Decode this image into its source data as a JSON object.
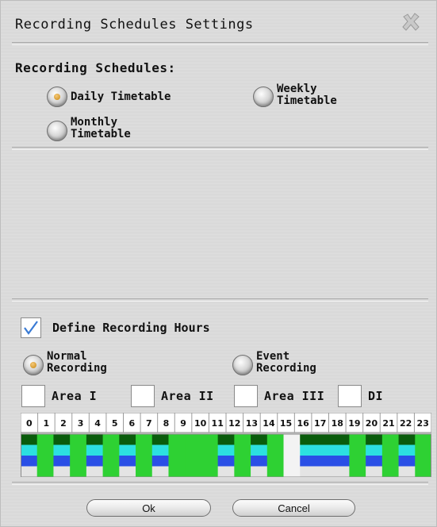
{
  "title": "Recording Schedules Settings",
  "schedules": {
    "heading": "Recording Schedules:",
    "daily": {
      "label": "Daily Timetable",
      "selected": true
    },
    "weekly": {
      "line1": "Weekly",
      "line2": "Timetable",
      "selected": false
    },
    "monthly": {
      "line1": "Monthly",
      "line2": "Timetable",
      "selected": false
    }
  },
  "define_hours": {
    "label": "Define Recording Hours",
    "checked": true
  },
  "mode": {
    "normal": {
      "line1": "Normal",
      "line2": "Recording",
      "selected": true
    },
    "event": {
      "line1": "Event",
      "line2": "Recording",
      "selected": false
    }
  },
  "areas": [
    {
      "label": "Area I",
      "checked": false
    },
    {
      "label": "Area II",
      "checked": false
    },
    {
      "label": "Area III",
      "checked": false
    },
    {
      "label": "DI",
      "checked": false
    }
  ],
  "hours": [
    "0",
    "1",
    "2",
    "3",
    "4",
    "5",
    "6",
    "7",
    "8",
    "9",
    "10",
    "11",
    "12",
    "13",
    "14",
    "15",
    "16",
    "17",
    "18",
    "19",
    "20",
    "21",
    "22",
    "23"
  ],
  "hour_pattern": [
    "multi",
    "green",
    "multi",
    "green",
    "multi",
    "green",
    "multi",
    "green",
    "multi",
    "green",
    "green",
    "green",
    "multi",
    "green",
    "multi",
    "green",
    "empty",
    "multi",
    "multi",
    "multi",
    "green",
    "multi",
    "green",
    "multi",
    "green"
  ],
  "colors": {
    "green": "#2ed133",
    "dark_green": "#0a5c0c",
    "cyan": "#2ce0e0",
    "blue": "#2a4fe6",
    "light_gray": "#e4e4e4"
  },
  "buttons": {
    "ok": "Ok",
    "cancel": "Cancel"
  }
}
